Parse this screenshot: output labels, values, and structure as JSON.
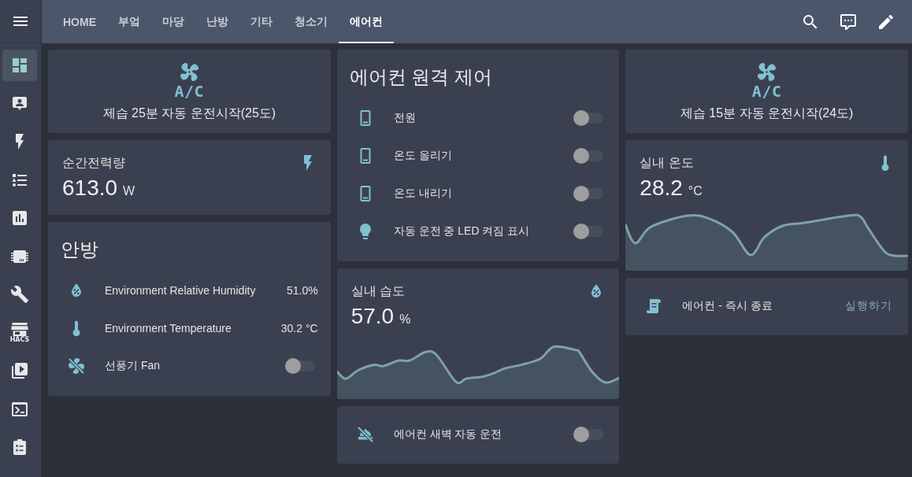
{
  "sidebar": {
    "items": [
      {
        "kind": "overview",
        "selected": true
      },
      {
        "kind": "people",
        "selected": false
      },
      {
        "kind": "energy",
        "selected": false
      },
      {
        "kind": "logbook",
        "selected": false
      },
      {
        "kind": "history",
        "selected": false
      },
      {
        "kind": "hardware",
        "selected": false
      },
      {
        "kind": "tools",
        "selected": false
      },
      {
        "kind": "store",
        "selected": false,
        "caption": "HACS"
      },
      {
        "kind": "media",
        "selected": false
      },
      {
        "kind": "terminal",
        "selected": false
      },
      {
        "kind": "checklist",
        "selected": false
      }
    ]
  },
  "top_bar": {
    "tabs": [
      {
        "label": "HOME",
        "selected": false
      },
      {
        "label": "부엌",
        "selected": false
      },
      {
        "label": "마당",
        "selected": false
      },
      {
        "label": "난방",
        "selected": false
      },
      {
        "label": "기타",
        "selected": false
      },
      {
        "label": "청소기",
        "selected": false
      },
      {
        "label": "에어컨",
        "selected": true
      }
    ]
  },
  "columns": [
    {
      "cards": [
        {
          "kind": "button",
          "icon_text": "A/C",
          "caption": "제습 25분 자동 운전시작(25도)"
        },
        {
          "kind": "power",
          "name": "순간전력량",
          "value": "613.0",
          "unit": "W"
        },
        {
          "kind": "entities",
          "title": "안방",
          "rows": [
            {
              "kind": "humidity",
              "name": "Environment Relative Humidity",
              "state": "51.0%"
            },
            {
              "kind": "temperature",
              "name": "Environment Temperature",
              "state": "30.2 °C"
            },
            {
              "kind": "fan",
              "name": "선풍기 Fan",
              "on": false
            }
          ]
        }
      ]
    },
    {
      "cards": [
        {
          "kind": "entities",
          "title": "에어컨 원격 제어",
          "rows": [
            {
              "kind": "remote",
              "name": "전원",
              "on": false
            },
            {
              "kind": "remote",
              "name": "온도 올리기",
              "on": false
            },
            {
              "kind": "remote",
              "name": "온도 내리기",
              "on": false
            },
            {
              "kind": "light",
              "name": "자동 운전 중 LED 켜짐 표시",
              "on": false
            }
          ]
        },
        {
          "kind": "humidity",
          "name": "실내 습도",
          "value": "57.0",
          "unit": "%",
          "graph": true
        },
        {
          "kind": "entities",
          "rows": [
            {
              "kind": "automation",
              "name": "에어컨 새벽 자동 운전",
              "on": false
            }
          ]
        }
      ]
    },
    {
      "cards": [
        {
          "kind": "button",
          "icon_text": "A/C",
          "caption": "제습 15분 자동 운전시작(24도)"
        },
        {
          "kind": "temperature",
          "name": "실내 온도",
          "value": "28.2",
          "unit": "°C",
          "graph": true
        },
        {
          "kind": "entities",
          "rows": [
            {
              "kind": "script",
              "name": "에어컨 - 즉시 종료",
              "action": "실행하기"
            }
          ]
        }
      ]
    }
  ]
}
